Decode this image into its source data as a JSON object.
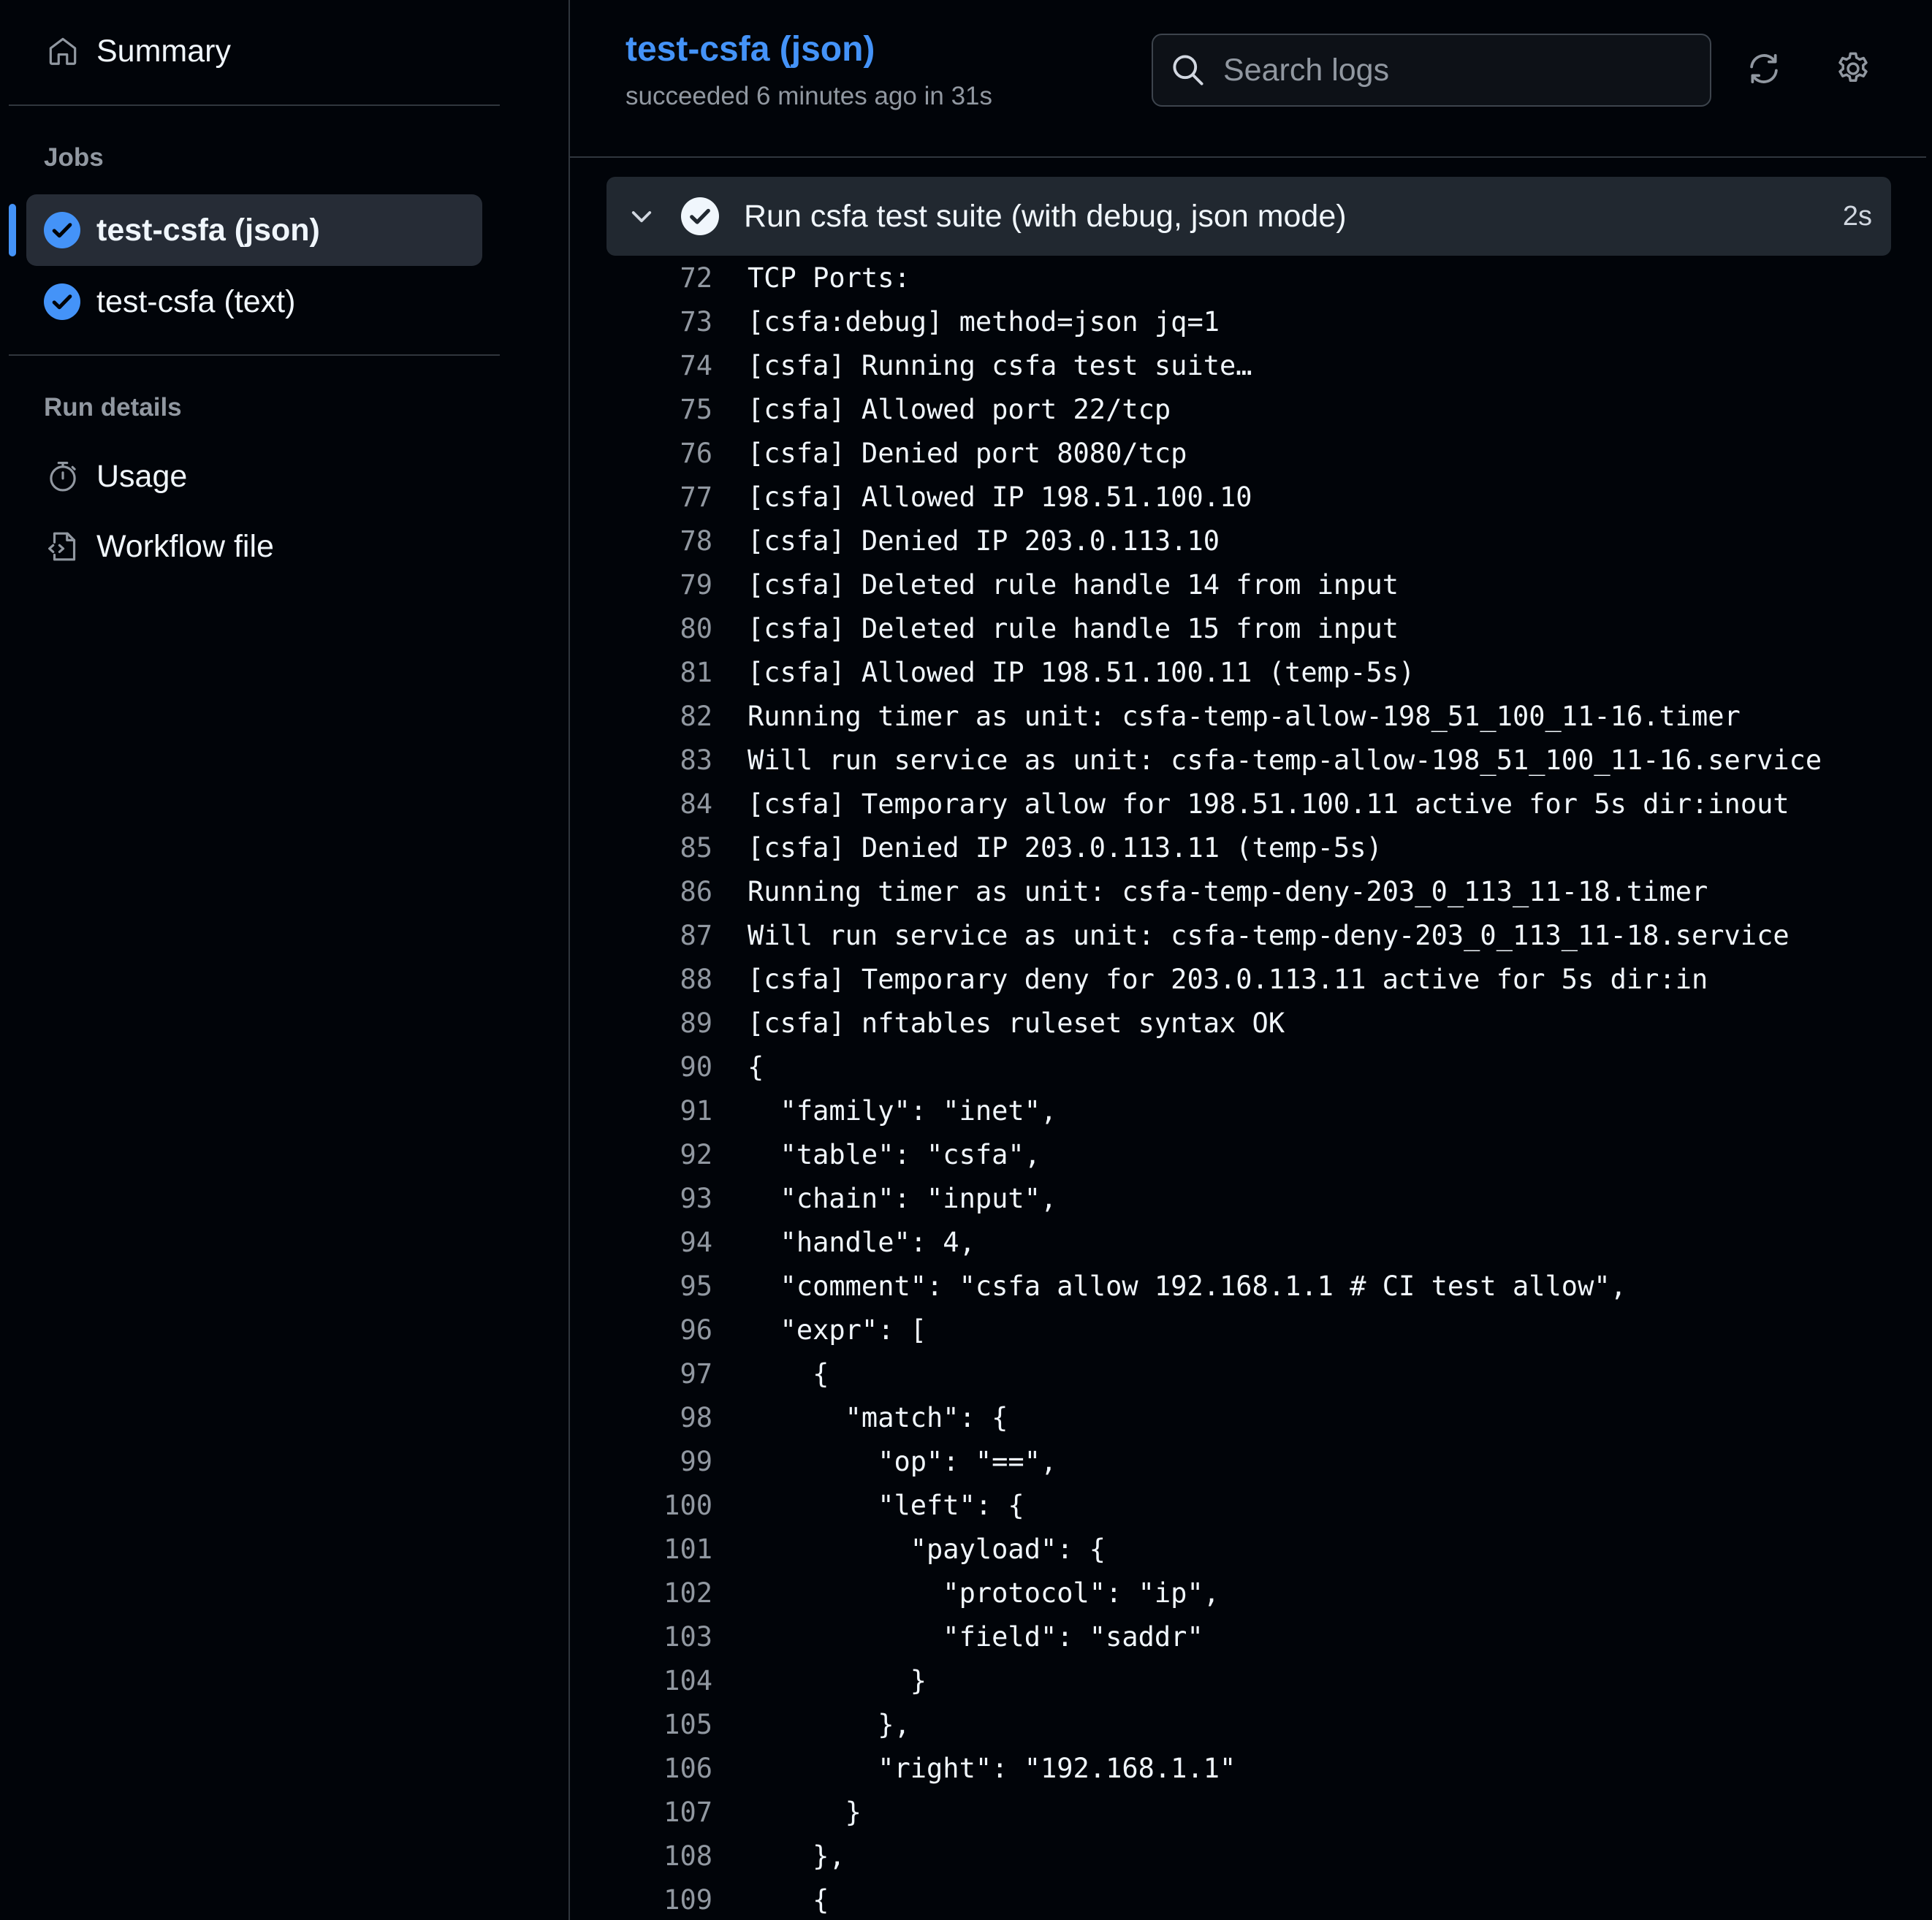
{
  "sidebar": {
    "summary_label": "Summary",
    "jobs_heading": "Jobs",
    "jobs": [
      {
        "label": "test-csfa (json)",
        "status": "success",
        "active": true
      },
      {
        "label": "test-csfa (text)",
        "status": "success",
        "active": false
      }
    ],
    "run_details_heading": "Run details",
    "usage_label": "Usage",
    "workflow_file_label": "Workflow file"
  },
  "header": {
    "title": "test-csfa (json)",
    "subtitle": "succeeded 6 minutes ago in 31s",
    "search_placeholder": "Search logs",
    "refresh_icon": "sync-icon",
    "settings_icon": "gear-icon"
  },
  "step": {
    "name": "Run csfa test suite (with debug, json mode)",
    "duration": "2s",
    "status": "success"
  },
  "log": {
    "lines": [
      {
        "n": "72",
        "t": "TCP Ports:"
      },
      {
        "n": "73",
        "t": "[csfa:debug] method=json jq=1"
      },
      {
        "n": "74",
        "t": "[csfa] Running csfa test suite…"
      },
      {
        "n": "75",
        "t": "[csfa] Allowed port 22/tcp"
      },
      {
        "n": "76",
        "t": "[csfa] Denied port 8080/tcp"
      },
      {
        "n": "77",
        "t": "[csfa] Allowed IP 198.51.100.10"
      },
      {
        "n": "78",
        "t": "[csfa] Denied IP 203.0.113.10"
      },
      {
        "n": "79",
        "t": "[csfa] Deleted rule handle 14 from input"
      },
      {
        "n": "80",
        "t": "[csfa] Deleted rule handle 15 from input"
      },
      {
        "n": "81",
        "t": "[csfa] Allowed IP 198.51.100.11 (temp-5s)"
      },
      {
        "n": "82",
        "t": "Running timer as unit: csfa-temp-allow-198_51_100_11-16.timer"
      },
      {
        "n": "83",
        "t": "Will run service as unit: csfa-temp-allow-198_51_100_11-16.service"
      },
      {
        "n": "84",
        "t": "[csfa] Temporary allow for 198.51.100.11 active for 5s dir:inout"
      },
      {
        "n": "85",
        "t": "[csfa] Denied IP 203.0.113.11 (temp-5s)"
      },
      {
        "n": "86",
        "t": "Running timer as unit: csfa-temp-deny-203_0_113_11-18.timer"
      },
      {
        "n": "87",
        "t": "Will run service as unit: csfa-temp-deny-203_0_113_11-18.service"
      },
      {
        "n": "88",
        "t": "[csfa] Temporary deny for 203.0.113.11 active for 5s dir:in"
      },
      {
        "n": "89",
        "t": "[csfa] nftables ruleset syntax OK"
      },
      {
        "n": "90",
        "t": "{"
      },
      {
        "n": "91",
        "t": "  \"family\": \"inet\","
      },
      {
        "n": "92",
        "t": "  \"table\": \"csfa\","
      },
      {
        "n": "93",
        "t": "  \"chain\": \"input\","
      },
      {
        "n": "94",
        "t": "  \"handle\": 4,"
      },
      {
        "n": "95",
        "t": "  \"comment\": \"csfa allow 192.168.1.1 # CI test allow\","
      },
      {
        "n": "96",
        "t": "  \"expr\": ["
      },
      {
        "n": "97",
        "t": "    {"
      },
      {
        "n": "98",
        "t": "      \"match\": {"
      },
      {
        "n": "99",
        "t": "        \"op\": \"==\","
      },
      {
        "n": "100",
        "t": "        \"left\": {"
      },
      {
        "n": "101",
        "t": "          \"payload\": {"
      },
      {
        "n": "102",
        "t": "            \"protocol\": \"ip\","
      },
      {
        "n": "103",
        "t": "            \"field\": \"saddr\""
      },
      {
        "n": "104",
        "t": "          }"
      },
      {
        "n": "105",
        "t": "        },"
      },
      {
        "n": "106",
        "t": "        \"right\": \"192.168.1.1\""
      },
      {
        "n": "107",
        "t": "      }"
      },
      {
        "n": "108",
        "t": "    },"
      },
      {
        "n": "109",
        "t": "    {"
      }
    ]
  },
  "colors": {
    "background": "#010409",
    "accent": "#4493f8",
    "border": "#30363d",
    "muted_text": "#9198a1",
    "step_header_bg": "#212830"
  }
}
